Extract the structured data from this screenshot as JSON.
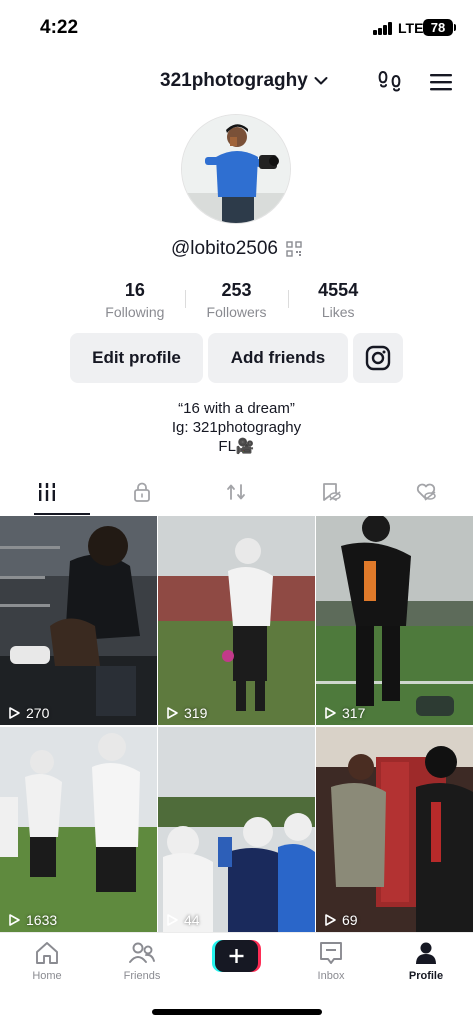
{
  "status_bar": {
    "time": "4:22",
    "network": "LTE",
    "battery": "78"
  },
  "header": {
    "account_name": "321photograghy"
  },
  "profile": {
    "username": "@lobito2506",
    "stats": [
      {
        "value": "16",
        "label": "Following"
      },
      {
        "value": "253",
        "label": "Followers"
      },
      {
        "value": "4554",
        "label": "Likes"
      }
    ],
    "buttons": {
      "edit_profile": "Edit profile",
      "add_friends": "Add friends"
    },
    "bio": [
      "“16 with a dream”",
      "Ig: 321photograghy",
      "FL🎥"
    ]
  },
  "tabs": [
    {
      "icon": "grid-icon",
      "active": true
    },
    {
      "icon": "lock-icon",
      "active": false
    },
    {
      "icon": "repost-icon",
      "active": false
    },
    {
      "icon": "favorites-hidden-icon",
      "active": false
    },
    {
      "icon": "liked-hidden-icon",
      "active": false
    }
  ],
  "videos": [
    {
      "views": "270"
    },
    {
      "views": "319"
    },
    {
      "views": "317"
    },
    {
      "views": "1633"
    },
    {
      "views": "44"
    },
    {
      "views": "69"
    }
  ],
  "bottom_nav": {
    "home": "Home",
    "friends": "Friends",
    "inbox": "Inbox",
    "profile": "Profile"
  },
  "colors": {
    "text": "#161823",
    "muted": "#8a8b91",
    "button_bg": "#eff0f2",
    "create_cyan": "#25f4ee",
    "create_red": "#fe2c55"
  }
}
